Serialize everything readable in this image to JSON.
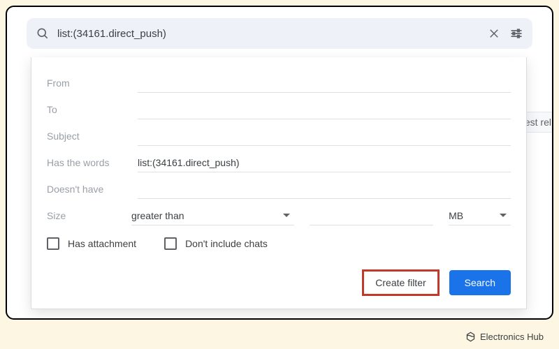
{
  "search": {
    "query": "list:(34161.direct_push)"
  },
  "filter": {
    "from_label": "From",
    "to_label": "To",
    "subject_label": "Subject",
    "haswords_label": "Has the words",
    "haswords_value": "list:(34161.direct_push)",
    "doesnthave_label": "Doesn't have",
    "size_label": "Size",
    "size_comparator": "greater than",
    "size_unit": "MB",
    "has_attachment_label": "Has attachment",
    "dont_include_chats_label": "Don't include chats",
    "create_filter_label": "Create filter",
    "search_button_label": "Search"
  },
  "background": {
    "truncated_text": "latest rel"
  },
  "watermark": {
    "text": "Electronics Hub"
  }
}
